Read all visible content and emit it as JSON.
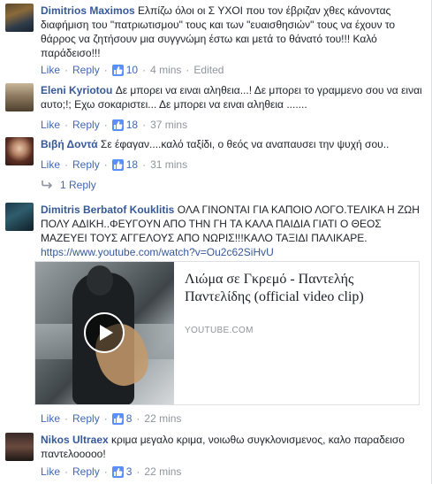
{
  "comments": [
    {
      "author": "Dimitrios Maximos",
      "text": "Ελπίζω όλοι οι Σ          ΥΧΟΙ που τον έβριζαν χθες κάνοντας διαφήμιση του \"πατριωτισμου\" τους και των \"ευαισθησιών\" τους να έχουν το θάρρος να ζητήσουν μια συγγνώμη έστω και μετά το θάνατό του!!! Καλό παράδεισο!!!",
      "like": "Like",
      "reply": "Reply",
      "likes": "10",
      "time": "4 mins",
      "edited": "Edited"
    },
    {
      "author": "Eleni Kyriotou",
      "text": "Δε μπορει να ειναι αληθεια...! Δε μπορει το γραμμενο σου να ειναι αυτο;!; Εχω σοκαριστει... Δε μπορει να ειναι αληθεια .......",
      "like": "Like",
      "reply": "Reply",
      "likes": "18",
      "time": "37 mins"
    },
    {
      "author": "Βιβή Δοντά",
      "text": "Σε έφαγαν....καλό ταξίδι, ο θεός να αναπαυσει την ψυχή σου..",
      "like": "Like",
      "reply": "Reply",
      "likes": "18",
      "time": "31 mins"
    },
    {
      "author": "Dimitris Berbatof Kouklitis",
      "text": "ΟΛΑ ΓΙΝΟΝΤΑΙ ΓΙΑ ΚΑΠΟΙΟ ΛΟΓΟ.ΤΕΛΙΚΑ Η ΖΩΗ ΠΟΛΥ ΑΔΙΚΗ..ΦΕΥΓΟΥΝ ΑΠΟ ΤΗΝ ΓΗ ΤΑ ΚΑΛΑ ΠΑΙΔΙΑ ΓΙΑΤΙ Ο ΘΕΟΣ ΜΑΖΕΥΕΙ ΤΟΥΣ ΑΓΓΕΛΟΥΣ ΑΠΟ ΝΩΡΙΣ!!!ΚΑΛΟ ΤΑΞΙΔΙ ΠΑΛΙΚΑΡΕ.",
      "link": "https://www.youtube.com/watch?v=Ou2c62SiHvU",
      "like": "Like",
      "reply": "Reply",
      "likes": "8",
      "time": "22 mins"
    },
    {
      "author": "Nikos Ultraex",
      "text": "κριμα μεγαλο κριμα, νοιωθω συγκλονισμενος, καλο παραδεισο παντελοοοοο!",
      "like": "Like",
      "reply": "Reply",
      "likes": "3",
      "time": "22 mins"
    }
  ],
  "replies_toggle": "1 Reply",
  "video_card": {
    "title": "Λιώμα σε Γκρεμό - Παντελής Παντελίδης (official video clip)",
    "domain": "YOUTUBE.COM"
  },
  "colors": {
    "author": "#365899",
    "action_link": "#4267b2",
    "meta": "#90949c",
    "like_badge": "#5890ff"
  }
}
